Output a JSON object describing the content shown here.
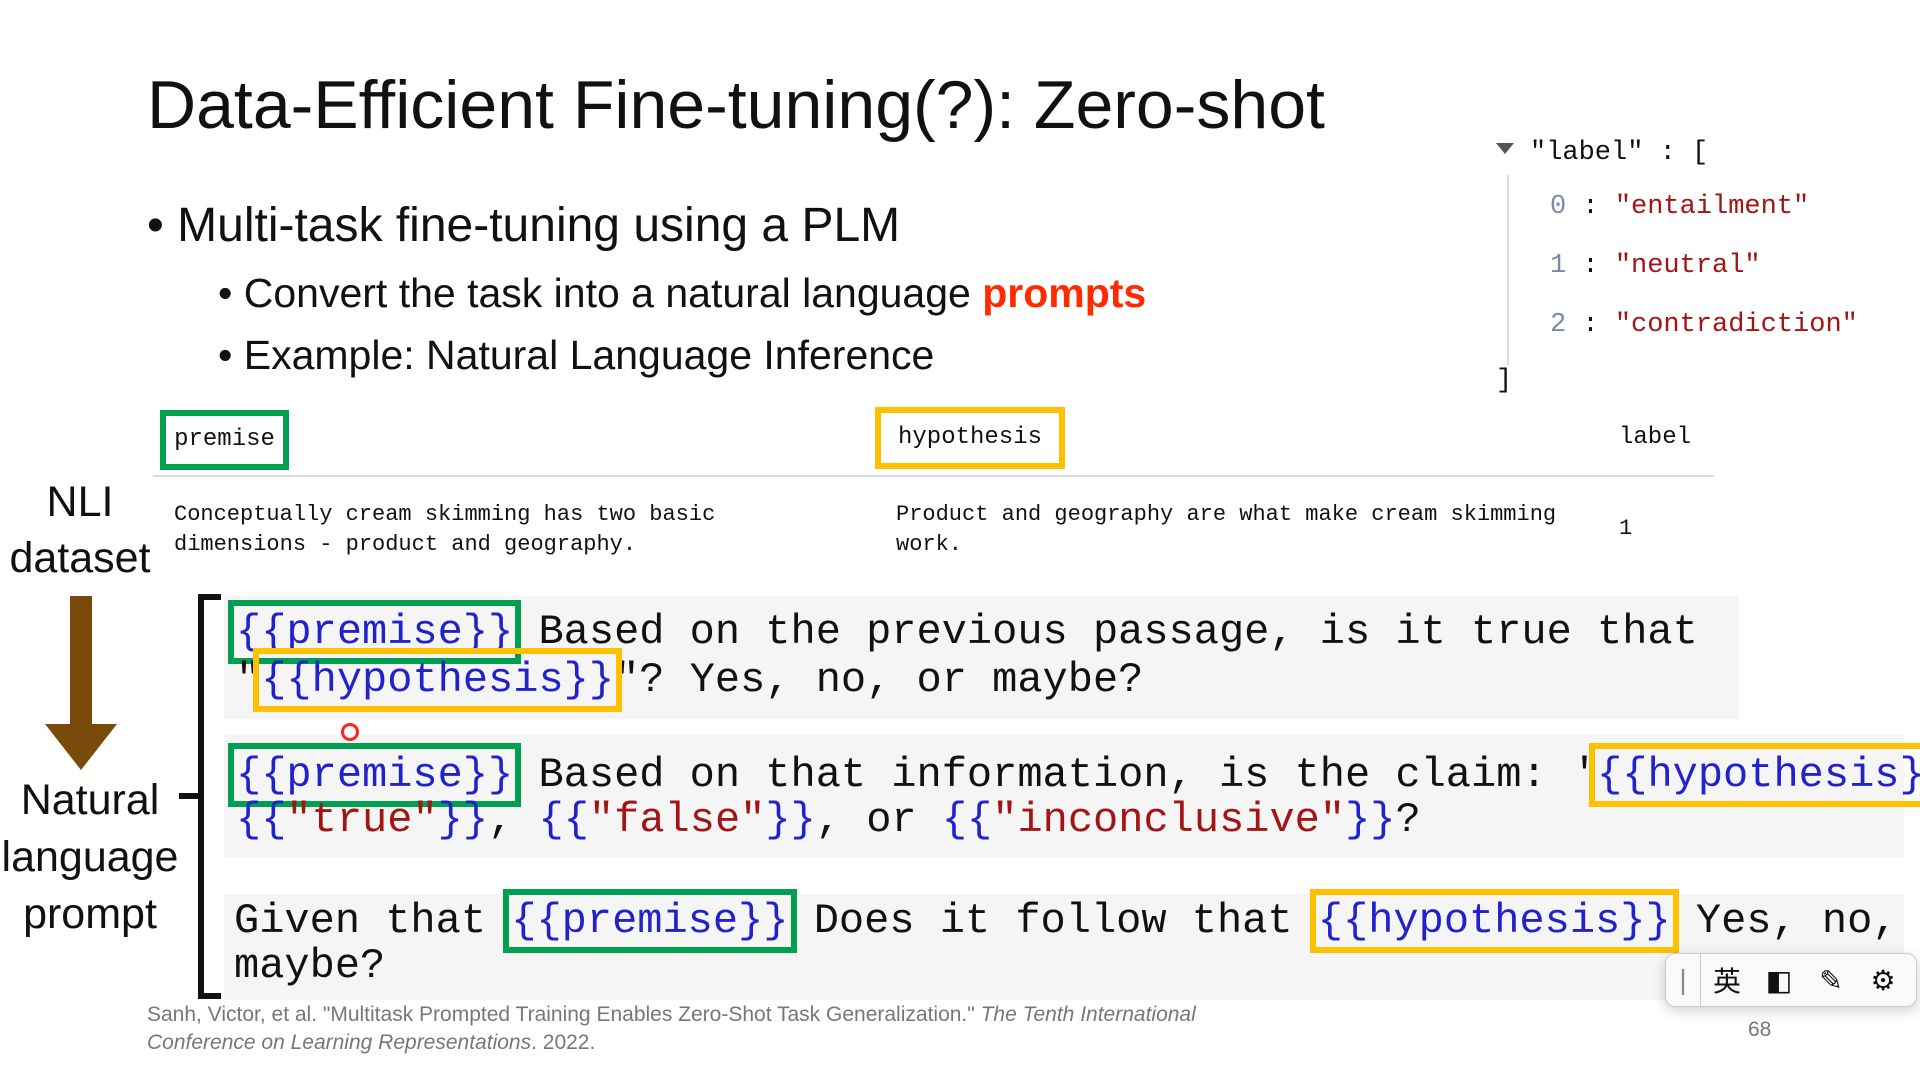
{
  "slide": {
    "title": "Data-Efficient Fine-tuning(?): Zero-shot",
    "bullet1": "Multi-task fine-tuning using a PLM",
    "bullet2_prefix": "Convert the task into a natural language ",
    "bullet2_highlight": "prompts",
    "bullet3": "Example: Natural Language Inference",
    "page_number": "68"
  },
  "json_panel": {
    "key_line": "\"label\" : [",
    "items": [
      {
        "index": "0",
        "value": "\"entailment\""
      },
      {
        "index": "1",
        "value": "\"neutral\""
      },
      {
        "index": "2",
        "value": "\"contradiction\""
      }
    ],
    "close": "]"
  },
  "table": {
    "headers": [
      "premise",
      "hypothesis",
      "label"
    ],
    "rows": [
      {
        "premise": "Conceptually cream skimming has two basic dimensions - product and geography.",
        "hypothesis": "Product and geography are what make cream skimming work.",
        "label": "1"
      }
    ]
  },
  "side_labels": {
    "nli_line1": "NLI",
    "nli_line2": "dataset",
    "prompt_line1": "Natural",
    "prompt_line2": "language",
    "prompt_line3": "prompt"
  },
  "prompts": {
    "p1_premise": "{{premise}}",
    "p1_text1": " Based on the previous passage, is it true that",
    "p1_q1": "\"",
    "p1_hyp": "{{hypothesis}}",
    "p1_text2": "\"? Yes, no, or maybe?",
    "p2_premise": "{{premise}}",
    "p2_text1": " Based on that information, is the claim: '",
    "p2_hyp": "{{hypothesis}}",
    "p2_q": "'",
    "p2_true": "\"true\"",
    "p2_false": "\"false\"",
    "p2_or": ", or ",
    "p2_incon": "\"inconclusive\"",
    "p3_text1": "Given that ",
    "p3_premise": "{{premise}}",
    "p3_text2": " Does it follow that ",
    "p3_hyp": "{{hypothesis}}",
    "p3_text3": " Yes, no, or",
    "p3_text4": "maybe?"
  },
  "citation": {
    "line1_plain": "Sanh, Victor, et al. \"Multitask Prompted Training Enables Zero-Shot Task Generalization.\" ",
    "line1_italic": "The Tenth International",
    "line2_italic": "Conference on Learning Representations",
    "line2_plain": ". 2022."
  },
  "ime_toolbar": {
    "lang": "英",
    "icons": [
      "handle-icon",
      "half-width-icon",
      "pen-icon",
      "gear-icon"
    ]
  },
  "colors": {
    "premise_box": "#00a050",
    "hypothesis_box": "#ffc000",
    "highlight": "#ff2a00",
    "arrow": "#7a4a0a"
  }
}
